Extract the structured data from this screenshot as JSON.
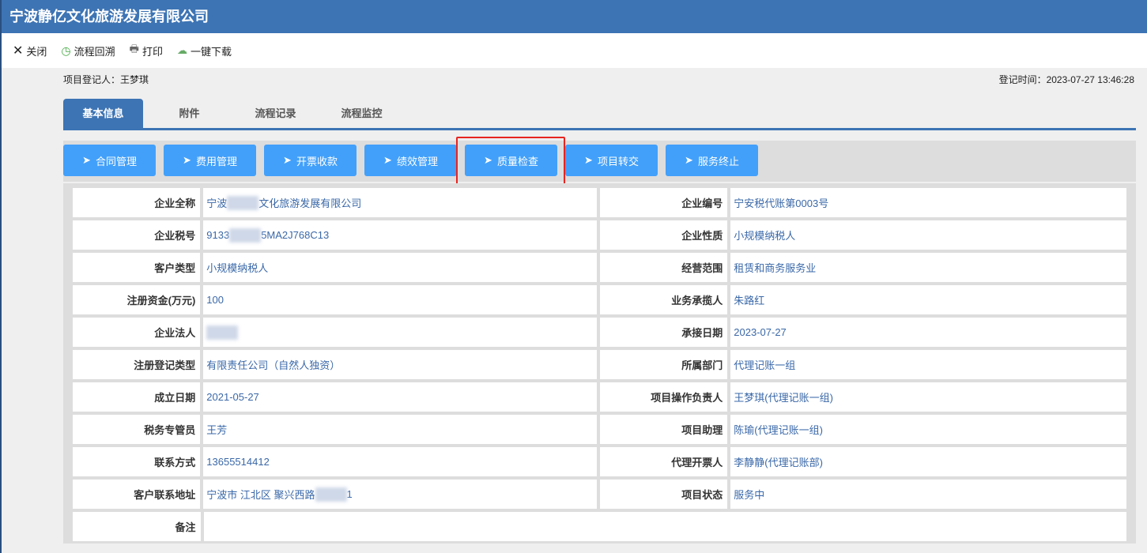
{
  "header": {
    "title": "宁波静亿文化旅游发展有限公司"
  },
  "toolbar": [
    {
      "label": "关闭",
      "icon": "close-icon"
    },
    {
      "label": "流程回溯",
      "icon": "history-icon"
    },
    {
      "label": "打印",
      "icon": "print-icon"
    },
    {
      "label": "一键下载",
      "icon": "download-icon"
    }
  ],
  "meta": {
    "registrant": "项目登记人：王梦琪",
    "reg_time": "登记时间：2023-07-27 13:46:28"
  },
  "tabs": [
    "基本信息",
    "附件",
    "流程记录",
    "流程监控"
  ],
  "actions": [
    "合同管理",
    "费用管理",
    "开票收款",
    "绩效管理",
    "质量检查",
    "项目转交",
    "服务终止"
  ],
  "rows": [
    {
      "l1": "企业全称",
      "v1a": "宁波",
      "v1b": "文化旅游发展有限公司",
      "blur1": true,
      "l2": "企业编号",
      "v2": "宁安税代账第0003号"
    },
    {
      "l1": "企业税号",
      "v1a": "9133",
      "v1b": "5MA2J768C13",
      "blur1": true,
      "l2": "企业性质",
      "v2": "小规模纳税人"
    },
    {
      "l1": "客户类型",
      "v1a": "小规模纳税人",
      "v1b": "",
      "l2": "经营范围",
      "v2": "租赁和商务服务业"
    },
    {
      "l1": "注册资金(万元)",
      "v1a": "100",
      "v1b": "",
      "l2": "业务承揽人",
      "v2": " 朱路红"
    },
    {
      "l1": "企业法人",
      "v1a": "",
      "v1b": "",
      "blur1": true,
      "l2": "承接日期",
      "v2": "2023-07-27"
    },
    {
      "l1": "注册登记类型",
      "v1a": "有限责任公司（自然人独资）",
      "v1b": "",
      "l2": "所属部门",
      "v2": " 代理记账一组"
    },
    {
      "l1": "成立日期",
      "v1a": "2021-05-27",
      "v1b": "",
      "l2": "项目操作负责人",
      "v2": " 王梦琪(代理记账一组)"
    },
    {
      "l1": "税务专管员",
      "v1a": "王芳",
      "v1b": "",
      "l2": "项目助理",
      "v2": " 陈瑜(代理记账一组)"
    },
    {
      "l1": "联系方式",
      "v1a": "13655514412",
      "v1b": "",
      "l2": "代理开票人",
      "v2": " 李静静(代理记账部)"
    },
    {
      "l1": "客户联系地址",
      "v1a": "宁波市  江北区  聚兴西路",
      "v1b": "1",
      "blur1": true,
      "l2": "项目状态",
      "v2": "服务中"
    }
  ],
  "remark": {
    "label": "备注",
    "value": ""
  }
}
